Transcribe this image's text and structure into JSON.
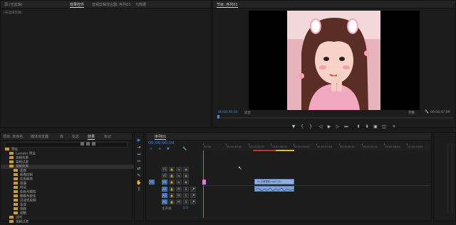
{
  "source_panel": {
    "tabs": [
      "源:(无剪辑)",
      "效果控件",
      "音频剪辑混合器: 序列01",
      "元数据"
    ],
    "active_tab": 1,
    "empty_label": "(未选择剪辑)"
  },
  "program_monitor": {
    "title": "节目: 序列01",
    "timecode": "00;00;00;04",
    "fit_label": "适合",
    "quality_label": "完整",
    "duration": "00;04;47;09"
  },
  "project_panel": {
    "tabs": [
      "项目: 未命名",
      "媒体浏览器",
      "库",
      "信息",
      "效果",
      "标记"
    ],
    "active_tab": 4,
    "items": [
      {
        "label": "预设",
        "kind": "folder",
        "level": 0
      },
      {
        "label": "Lumetri 预设",
        "kind": "folder",
        "level": 1
      },
      {
        "label": "音频效果",
        "kind": "folder",
        "level": 1
      },
      {
        "label": "音频过渡",
        "kind": "folder",
        "level": 1
      },
      {
        "label": "视频效果",
        "kind": "folder",
        "level": 1
      },
      {
        "label": "变换",
        "kind": "folder",
        "level": 2
      },
      {
        "label": "图像控制",
        "kind": "folder",
        "level": 2
      },
      {
        "label": "实用程序",
        "kind": "folder",
        "level": 2
      },
      {
        "label": "扭曲",
        "kind": "folder",
        "level": 2
      },
      {
        "label": "时间",
        "kind": "folder",
        "level": 2
      },
      {
        "label": "杂色与颗粒",
        "kind": "folder",
        "level": 2
      },
      {
        "label": "模糊与锐化",
        "kind": "folder",
        "level": 2
      },
      {
        "label": "沉浸式视频",
        "kind": "folder",
        "level": 2
      },
      {
        "label": "生成",
        "kind": "folder",
        "level": 2
      },
      {
        "label": "视频",
        "kind": "folder",
        "level": 2
      },
      {
        "label": "调整",
        "kind": "folder",
        "level": 2
      },
      {
        "label": "过时",
        "kind": "folder",
        "level": 1
      },
      {
        "label": "视频过渡",
        "kind": "folder",
        "level": 1
      }
    ]
  },
  "timeline": {
    "title": "序列01",
    "timecode": "00;00;00;04",
    "ruler_labels": [
      "00;00",
      "00;00;16;00",
      "00;00;32;00",
      "00;00;48;00",
      "00;01;04;02",
      "00;01;20;02",
      "00;01;36;02",
      "00;01;52;02",
      "00;02;08;04",
      "00;02;24;04"
    ],
    "video_tracks": [
      "V3",
      "V2",
      "V1"
    ],
    "audio_tracks": [
      "A1",
      "A2",
      "A3"
    ],
    "master_label": "主声道",
    "master_value": "0.0",
    "clip_label": "fx 抖音视频.mp4 [V]"
  },
  "colors": {
    "accent": "#3a8be0",
    "clip_video": "#8fb0de",
    "clip_audio": "#7ea3d4",
    "marker_pink": "#e07ad8",
    "work_red": "#cc2b2b",
    "work_yellow": "#d8c020"
  }
}
